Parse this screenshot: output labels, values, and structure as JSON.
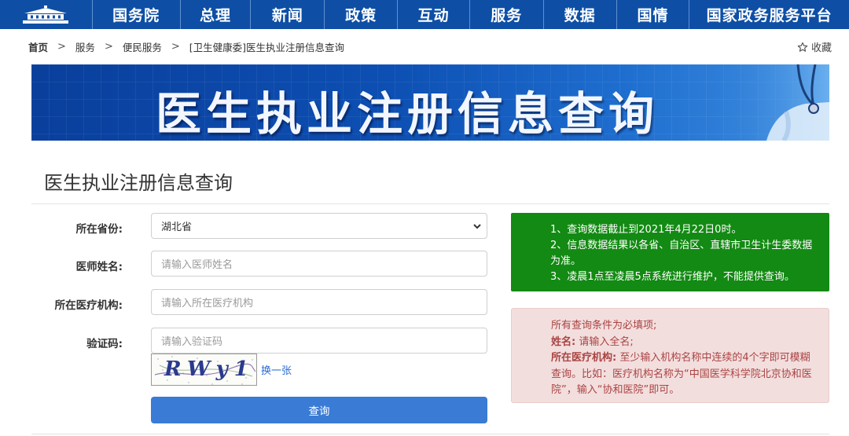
{
  "nav": {
    "logo_icon": "state-council-building-icon",
    "items": [
      "国务院",
      "总理",
      "新闻",
      "政策",
      "互动",
      "服务",
      "数据",
      "国情",
      "国家政务服务平台"
    ]
  },
  "breadcrumb": {
    "items": [
      "首页",
      "服务",
      "便民服务",
      "[卫生健康委]医生执业注册信息查询"
    ],
    "separator": ">"
  },
  "favorite": {
    "label": "收藏",
    "icon": "star-icon"
  },
  "banner": {
    "title": "医生执业注册信息查询"
  },
  "page_title": "医生执业注册信息查询",
  "form": {
    "province_label": "所在省份:",
    "province_value": "湖北省",
    "name_label": "医师姓名:",
    "name_placeholder": "请输入医师姓名",
    "org_label": "所在医疗机构:",
    "org_placeholder": "请输入所在医疗机构",
    "captcha_label": "验证码:",
    "captcha_placeholder": "请输入验证码",
    "captcha_text": "RWy1",
    "refresh_label": "换一张",
    "submit_label": "查询"
  },
  "notice_green": {
    "lines": [
      "1、查询数据截止到2021年4月22日0时。",
      "2、信息数据结果以各省、自治区、直辖市卫生计生委数据为准。",
      "3、凌晨1点至凌晨5点系统进行维护，不能提供查询。"
    ]
  },
  "notice_red": {
    "intro": "所有查询条件为必填项;",
    "name_term": "姓名:",
    "name_desc": "请输入全名;",
    "org_term": "所在医疗机构:",
    "org_desc": "至少输入机构名称中连续的4个字即可模糊查询。比如：医疗机构名称为“中国医学科学院北京协和医院”，输入“协和医院”即可。"
  },
  "colors": {
    "nav_bg": "#0e4fa5",
    "notice_green_bg": "#138a13",
    "notice_red_bg": "#f3dede",
    "notice_red_text": "#a94442",
    "submit_bg": "#3a7bd5"
  }
}
